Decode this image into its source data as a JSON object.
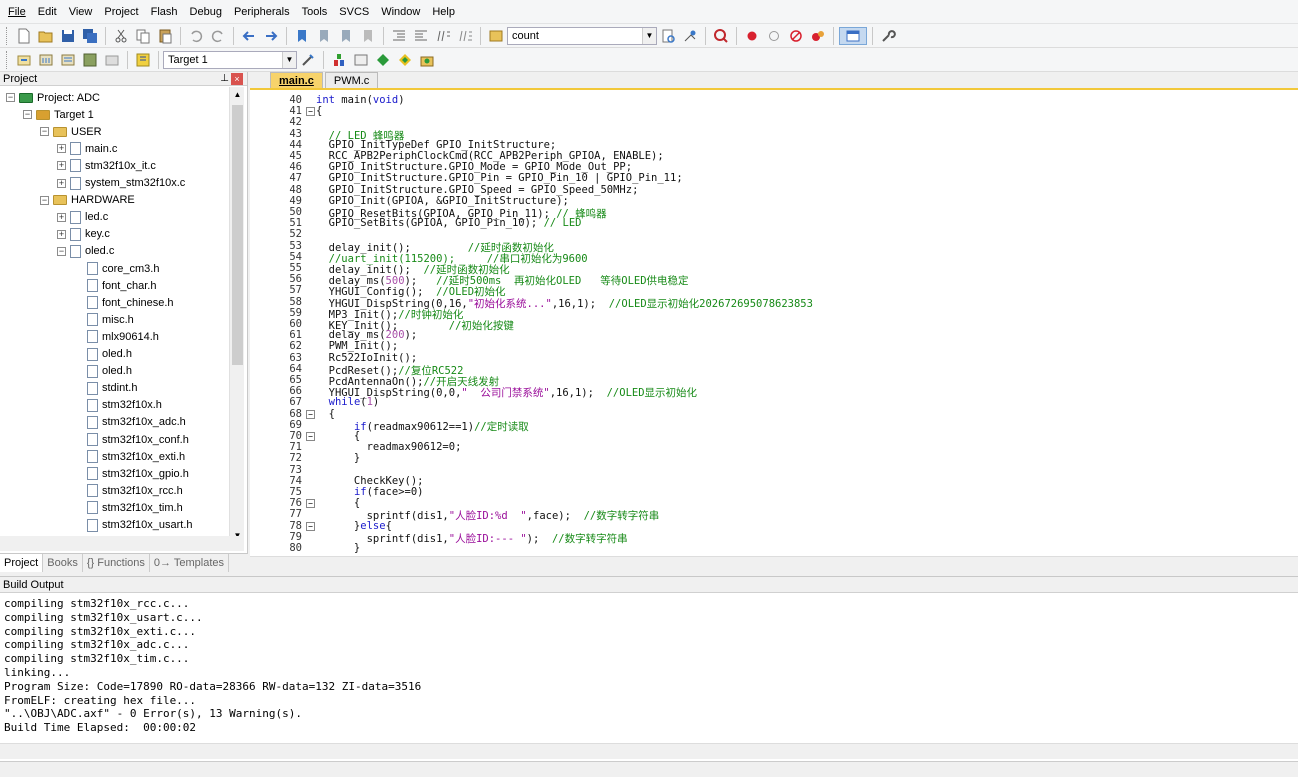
{
  "menu": [
    "File",
    "Edit",
    "View",
    "Project",
    "Flash",
    "Debug",
    "Peripherals",
    "Tools",
    "SVCS",
    "Window",
    "Help"
  ],
  "toolbar1": {
    "find_combo_value": "count"
  },
  "toolbar2": {
    "target_combo_value": "Target 1"
  },
  "project_panel": {
    "title": "Project",
    "tree": [
      {
        "label": "Project: ADC",
        "level": 0,
        "type": "project",
        "exp": "-"
      },
      {
        "label": "Target 1",
        "level": 1,
        "type": "target",
        "exp": "-"
      },
      {
        "label": "USER",
        "level": 2,
        "type": "folder",
        "exp": "-"
      },
      {
        "label": "main.c",
        "level": 3,
        "type": "file",
        "exp": "+"
      },
      {
        "label": "stm32f10x_it.c",
        "level": 3,
        "type": "file",
        "exp": "+"
      },
      {
        "label": "system_stm32f10x.c",
        "level": 3,
        "type": "file",
        "exp": "+"
      },
      {
        "label": "HARDWARE",
        "level": 2,
        "type": "folder",
        "exp": "-"
      },
      {
        "label": "led.c",
        "level": 3,
        "type": "file",
        "exp": "+"
      },
      {
        "label": "key.c",
        "level": 3,
        "type": "file",
        "exp": "+"
      },
      {
        "label": "oled.c",
        "level": 3,
        "type": "file",
        "exp": "-"
      },
      {
        "label": "core_cm3.h",
        "level": 4,
        "type": "file",
        "exp": ""
      },
      {
        "label": "font_char.h",
        "level": 4,
        "type": "file",
        "exp": ""
      },
      {
        "label": "font_chinese.h",
        "level": 4,
        "type": "file",
        "exp": ""
      },
      {
        "label": "misc.h",
        "level": 4,
        "type": "file",
        "exp": ""
      },
      {
        "label": "mlx90614.h",
        "level": 4,
        "type": "file",
        "exp": ""
      },
      {
        "label": "oled.h",
        "level": 4,
        "type": "file",
        "exp": ""
      },
      {
        "label": "oled.h",
        "level": 4,
        "type": "file",
        "exp": ""
      },
      {
        "label": "stdint.h",
        "level": 4,
        "type": "file",
        "exp": ""
      },
      {
        "label": "stm32f10x.h",
        "level": 4,
        "type": "file",
        "exp": ""
      },
      {
        "label": "stm32f10x_adc.h",
        "level": 4,
        "type": "file",
        "exp": ""
      },
      {
        "label": "stm32f10x_conf.h",
        "level": 4,
        "type": "file",
        "exp": ""
      },
      {
        "label": "stm32f10x_exti.h",
        "level": 4,
        "type": "file",
        "exp": ""
      },
      {
        "label": "stm32f10x_gpio.h",
        "level": 4,
        "type": "file",
        "exp": ""
      },
      {
        "label": "stm32f10x_rcc.h",
        "level": 4,
        "type": "file",
        "exp": ""
      },
      {
        "label": "stm32f10x_tim.h",
        "level": 4,
        "type": "file",
        "exp": ""
      },
      {
        "label": "stm32f10x_usart.h",
        "level": 4,
        "type": "file",
        "exp": ""
      }
    ],
    "tabs": [
      "Project",
      "Books",
      "{} Functions",
      "0→ Templates"
    ]
  },
  "editor": {
    "tabs": [
      "main.c",
      "PWM.c"
    ],
    "lines": [
      {
        "n": "40",
        "t": "int main(void)",
        "fold": ""
      },
      {
        "n": "41",
        "t": "{",
        "fold": "-"
      },
      {
        "n": "42",
        "t": "",
        "fold": ""
      },
      {
        "n": "43",
        "t": "  // LED 蜂鸣器",
        "fold": ""
      },
      {
        "n": "44",
        "t": "  GPIO_InitTypeDef GPIO_InitStructure;",
        "fold": ""
      },
      {
        "n": "45",
        "t": "  RCC_APB2PeriphClockCmd(RCC_APB2Periph_GPIOA, ENABLE);",
        "fold": ""
      },
      {
        "n": "46",
        "t": "  GPIO_InitStructure.GPIO_Mode = GPIO_Mode_Out_PP;",
        "fold": ""
      },
      {
        "n": "47",
        "t": "  GPIO_InitStructure.GPIO_Pin = GPIO_Pin_10 | GPIO_Pin_11;",
        "fold": ""
      },
      {
        "n": "48",
        "t": "  GPIO_InitStructure.GPIO_Speed = GPIO_Speed_50MHz;",
        "fold": ""
      },
      {
        "n": "49",
        "t": "  GPIO_Init(GPIOA, &GPIO_InitStructure);",
        "fold": ""
      },
      {
        "n": "50",
        "t": "  GPIO_ResetBits(GPIOA, GPIO_Pin_11); // 蜂鸣器",
        "fold": ""
      },
      {
        "n": "51",
        "t": "  GPIO_SetBits(GPIOA, GPIO_Pin_10); // LED",
        "fold": ""
      },
      {
        "n": "52",
        "t": "",
        "fold": ""
      },
      {
        "n": "53",
        "t": "  delay_init();         //延时函数初始化",
        "fold": ""
      },
      {
        "n": "54",
        "t": "  //uart_init(115200);     //串口初始化为9600",
        "fold": ""
      },
      {
        "n": "55",
        "t": "  delay_init();  //延时函数初始化",
        "fold": ""
      },
      {
        "n": "56",
        "t": "  delay_ms(500);   //延时500ms  再初始化OLED   等待OLED供电稳定",
        "fold": ""
      },
      {
        "n": "57",
        "t": "  YHGUI_Config();  //OLED初始化",
        "fold": ""
      },
      {
        "n": "58",
        "t": "  YHGUI_DispString(0,16,\"初始化系统...\",16,1);  //OLED显示初始化202672695078623853",
        "fold": ""
      },
      {
        "n": "59",
        "t": "  MP3_Init();//时钟初始化",
        "fold": ""
      },
      {
        "n": "60",
        "t": "  KEY_Init();        //初始化按键",
        "fold": ""
      },
      {
        "n": "61",
        "t": "  delay_ms(200);",
        "fold": ""
      },
      {
        "n": "62",
        "t": "  PWM_Init();",
        "fold": ""
      },
      {
        "n": "63",
        "t": "  Rc522IoInit();",
        "fold": ""
      },
      {
        "n": "64",
        "t": "  PcdReset();//复位RC522",
        "fold": ""
      },
      {
        "n": "65",
        "t": "  PcdAntennaOn();//开启天线发射",
        "fold": ""
      },
      {
        "n": "66",
        "t": "  YHGUI_DispString(0,0,\"  公司门禁系统\",16,1);  //OLED显示初始化",
        "fold": ""
      },
      {
        "n": "67",
        "t": "  while(1)",
        "fold": ""
      },
      {
        "n": "68",
        "t": "  {",
        "fold": "-"
      },
      {
        "n": "69",
        "t": "      if(readmax90612==1)//定时读取",
        "fold": ""
      },
      {
        "n": "70",
        "t": "      {",
        "fold": "-"
      },
      {
        "n": "71",
        "t": "        readmax90612=0;",
        "fold": ""
      },
      {
        "n": "72",
        "t": "      }",
        "fold": ""
      },
      {
        "n": "73",
        "t": "",
        "fold": ""
      },
      {
        "n": "74",
        "t": "      CheckKey();",
        "fold": ""
      },
      {
        "n": "75",
        "t": "      if(face>=0)",
        "fold": ""
      },
      {
        "n": "76",
        "t": "      {",
        "fold": "-"
      },
      {
        "n": "77",
        "t": "        sprintf(dis1,\"人脸ID:%d  \",face);  //数字转字符串",
        "fold": ""
      },
      {
        "n": "78",
        "t": "      }else{",
        "fold": "-"
      },
      {
        "n": "79",
        "t": "        sprintf(dis1,\"人脸ID:--- \");  //数字转字符串",
        "fold": ""
      },
      {
        "n": "80",
        "t": "      }",
        "fold": ""
      }
    ]
  },
  "build_output": {
    "title": "Build Output",
    "lines": [
      "compiling stm32f10x_rcc.c...",
      "compiling stm32f10x_usart.c...",
      "compiling stm32f10x_exti.c...",
      "compiling stm32f10x_adc.c...",
      "compiling stm32f10x_tim.c...",
      "linking...",
      "Program Size: Code=17890 RO-data=28366 RW-data=132 ZI-data=3516",
      "FromELF: creating hex file...",
      "\"..\\OBJ\\ADC.axf\" - 0 Error(s), 13 Warning(s).",
      "Build Time Elapsed:  00:00:02"
    ]
  },
  "colors": {
    "active_tab": "#f7d36b",
    "keyword": "#1a1acc",
    "comment": "#178a17",
    "string": "#9a0e9a"
  }
}
